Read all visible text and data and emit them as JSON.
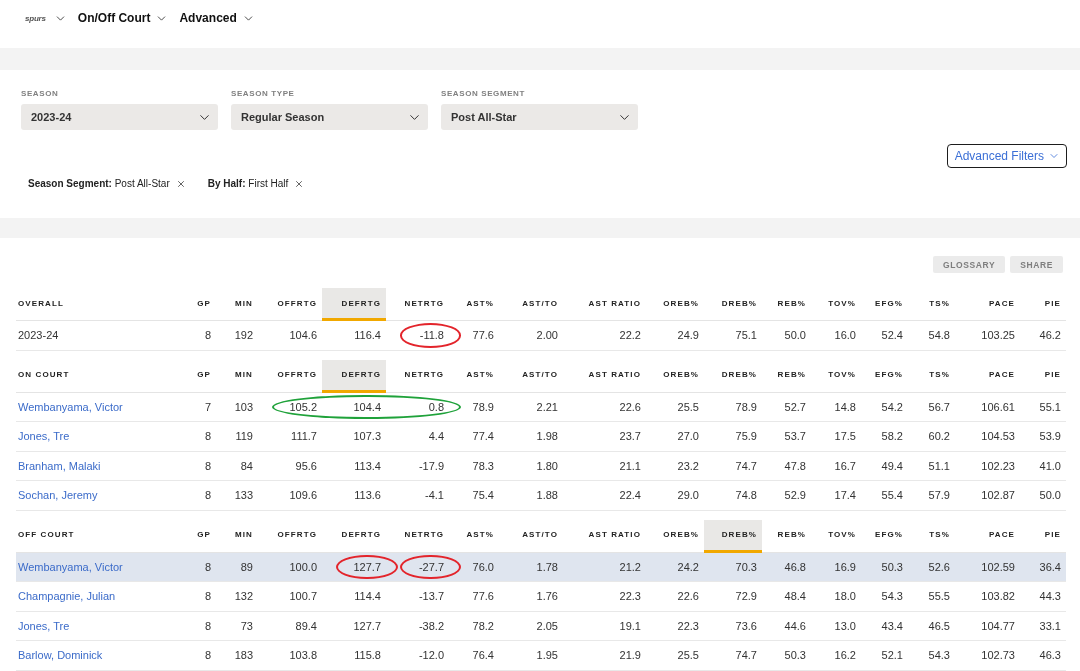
{
  "nav": {
    "logo": "spurs",
    "menus": [
      {
        "label": "On/Off Court"
      },
      {
        "label": "Advanced"
      }
    ]
  },
  "filters": {
    "dropdowns": [
      {
        "label": "SEASON",
        "value": "2023-24"
      },
      {
        "label": "SEASON TYPE",
        "value": "Regular Season"
      },
      {
        "label": "SEASON SEGMENT",
        "value": "Post All-Star"
      }
    ],
    "advanced_button": "Advanced Filters",
    "chips": [
      {
        "text": "**Season Segment:** Post All-Star"
      },
      {
        "text": "**By Half:** First Half"
      }
    ]
  },
  "toolbar": {
    "buttons": [
      {
        "label": "GLOSSARY",
        "disabled": true
      },
      {
        "label": "SHARE",
        "disabled": true
      }
    ]
  },
  "sections": [
    {
      "columns": [
        {
          "label": "OVERALL",
          "sorted": false
        },
        {
          "label": "GP",
          "sorted": false
        },
        {
          "label": "MIN",
          "sorted": false
        },
        {
          "label": "OFFRTG",
          "sorted": false
        },
        {
          "label": "DEFRTG",
          "sorted": true
        },
        {
          "label": "NETRTG",
          "sorted": false
        },
        {
          "label": "AST%",
          "sorted": false
        },
        {
          "label": "AST/TO",
          "sorted": false
        },
        {
          "label": "AST RATIO",
          "sorted": false
        },
        {
          "label": "OREB%",
          "sorted": false
        },
        {
          "label": "DREB%",
          "sorted": false
        },
        {
          "label": "REB%",
          "sorted": false
        },
        {
          "label": "TOV%",
          "sorted": false
        },
        {
          "label": "EFG%",
          "sorted": false
        },
        {
          "label": "TS%",
          "sorted": false
        },
        {
          "label": "PACE",
          "sorted": false
        },
        {
          "label": "PIE",
          "sorted": false
        }
      ],
      "rows": [
        {
          "kind": "season",
          "selected": false,
          "cells": [
            "2023-24",
            "8",
            "192",
            "104.6",
            "116.4",
            {
              "text": "-11.8",
              "color": "#e3242b",
              "joined": false
            },
            "77.6",
            "2.00",
            "22.2",
            "24.9",
            "75.1",
            "50.0",
            "16.0",
            "52.4",
            "54.8",
            "103.25",
            "46.2"
          ]
        }
      ]
    },
    {
      "columns": [
        {
          "label": "ON COURT",
          "sorted": false
        },
        {
          "label": "GP",
          "sorted": false
        },
        {
          "label": "MIN",
          "sorted": false
        },
        {
          "label": "OFFRTG",
          "sorted": false
        },
        {
          "label": "DEFRTG",
          "sorted": true
        },
        {
          "label": "NETRTG",
          "sorted": false
        },
        {
          "label": "AST%",
          "sorted": false
        },
        {
          "label": "AST/TO",
          "sorted": false
        },
        {
          "label": "AST RATIO",
          "sorted": false
        },
        {
          "label": "OREB%",
          "sorted": false
        },
        {
          "label": "DREB%",
          "sorted": false
        },
        {
          "label": "REB%",
          "sorted": false
        },
        {
          "label": "TOV%",
          "sorted": false
        },
        {
          "label": "EFG%",
          "sorted": false
        },
        {
          "label": "TS%",
          "sorted": false
        },
        {
          "label": "PACE",
          "sorted": false
        },
        {
          "label": "PIE",
          "sorted": false
        }
      ],
      "rows": [
        {
          "kind": "player",
          "selected": false,
          "cells": [
            "Wembanyama, Victor",
            "7",
            "103",
            {
              "text": "105.2",
              "color": "#1fa23a",
              "joined": false
            },
            {
              "text": "104.4",
              "color": "#1fa23a",
              "joined": true
            },
            {
              "text": "0.8",
              "color": "#1fa23a",
              "joined": true
            },
            "78.9",
            "2.21",
            "22.6",
            "25.5",
            "78.9",
            "52.7",
            "14.8",
            "54.2",
            "56.7",
            "106.61",
            "55.1"
          ]
        },
        {
          "kind": "player",
          "selected": false,
          "cells": [
            "Jones, Tre",
            "8",
            "119",
            "111.7",
            "107.3",
            "4.4",
            "77.4",
            "1.98",
            "23.7",
            "27.0",
            "75.9",
            "53.7",
            "17.5",
            "58.2",
            "60.2",
            "104.53",
            "53.9"
          ]
        },
        {
          "kind": "player",
          "selected": false,
          "cells": [
            "Branham, Malaki",
            "8",
            "84",
            "95.6",
            "113.4",
            "-17.9",
            "78.3",
            "1.80",
            "21.1",
            "23.2",
            "74.7",
            "47.8",
            "16.7",
            "49.4",
            "51.1",
            "102.23",
            "41.0"
          ]
        },
        {
          "kind": "player",
          "selected": false,
          "cells": [
            "Sochan, Jeremy",
            "8",
            "133",
            "109.6",
            "113.6",
            "-4.1",
            "75.4",
            "1.88",
            "22.4",
            "29.0",
            "74.8",
            "52.9",
            "17.4",
            "55.4",
            "57.9",
            "102.87",
            "50.0"
          ]
        }
      ]
    },
    {
      "columns": [
        {
          "label": "OFF COURT",
          "sorted": false
        },
        {
          "label": "GP",
          "sorted": false
        },
        {
          "label": "MIN",
          "sorted": false
        },
        {
          "label": "OFFRTG",
          "sorted": false
        },
        {
          "label": "DEFRTG",
          "sorted": false
        },
        {
          "label": "NETRTG",
          "sorted": false
        },
        {
          "label": "AST%",
          "sorted": false
        },
        {
          "label": "AST/TO",
          "sorted": false
        },
        {
          "label": "AST RATIO",
          "sorted": false
        },
        {
          "label": "OREB%",
          "sorted": false
        },
        {
          "label": "DREB%",
          "sorted": true
        },
        {
          "label": "REB%",
          "sorted": false
        },
        {
          "label": "TOV%",
          "sorted": false
        },
        {
          "label": "EFG%",
          "sorted": false
        },
        {
          "label": "TS%",
          "sorted": false
        },
        {
          "label": "PACE",
          "sorted": false
        },
        {
          "label": "PIE",
          "sorted": false
        }
      ],
      "rows": [
        {
          "kind": "player",
          "selected": true,
          "cells": [
            "Wembanyama, Victor",
            "8",
            "89",
            "100.0",
            {
              "text": "127.7",
              "color": "#e3242b",
              "joined": false
            },
            {
              "text": "-27.7",
              "color": "#e3242b",
              "joined": false
            },
            "76.0",
            "1.78",
            "21.2",
            "24.2",
            "70.3",
            "46.8",
            "16.9",
            "50.3",
            "52.6",
            "102.59",
            "36.4"
          ]
        },
        {
          "kind": "player",
          "selected": false,
          "cells": [
            "Champagnie, Julian",
            "8",
            "132",
            "100.7",
            "114.4",
            "-13.7",
            "77.6",
            "1.76",
            "22.3",
            "22.6",
            "72.9",
            "48.4",
            "18.0",
            "54.3",
            "55.5",
            "103.82",
            "44.3"
          ]
        },
        {
          "kind": "player",
          "selected": false,
          "cells": [
            "Jones, Tre",
            "8",
            "73",
            "89.4",
            "127.7",
            "-38.2",
            "78.2",
            "2.05",
            "19.1",
            "22.3",
            "73.6",
            "44.6",
            "13.0",
            "43.4",
            "46.5",
            "104.77",
            "33.1"
          ]
        },
        {
          "kind": "player",
          "selected": false,
          "cells": [
            "Barlow, Dominick",
            "8",
            "183",
            "103.8",
            "115.8",
            "-12.0",
            "76.4",
            "1.95",
            "21.9",
            "25.5",
            "74.7",
            "50.3",
            "16.2",
            "52.1",
            "54.3",
            "102.73",
            "46.3"
          ]
        }
      ]
    }
  ]
}
